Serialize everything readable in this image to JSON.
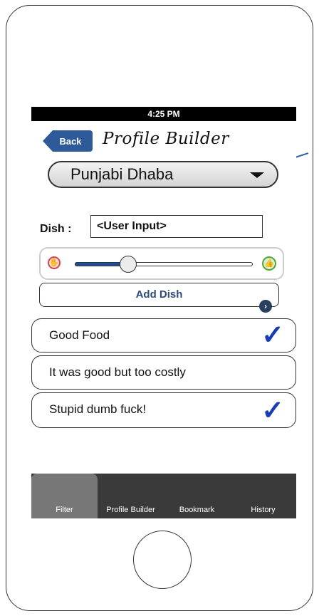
{
  "status_bar": {
    "time": "4:25 PM"
  },
  "nav": {
    "back_label": "Back",
    "title": "Profile Builder"
  },
  "restaurant_select": {
    "selected": "Punjabi Dhaba"
  },
  "dish": {
    "label": "Dish :",
    "value": "<User Input>"
  },
  "rating_slider": {
    "value": 0.3
  },
  "add_dish": {
    "label": "Add Dish"
  },
  "reviews": [
    {
      "text": "Good Food",
      "checked": true
    },
    {
      "text": "It was good but too costly",
      "checked": false
    },
    {
      "text": "Stupid dumb fuck!",
      "checked": true
    }
  ],
  "tabs": [
    {
      "label": "Filter",
      "active": true
    },
    {
      "label": "Profile Builder",
      "active": false
    },
    {
      "label": "Bookmark",
      "active": false
    },
    {
      "label": "History",
      "active": false
    }
  ],
  "colors": {
    "accent": "#2e5a9a",
    "check": "#1a3db4",
    "tabbar": "#3a3a3a"
  },
  "icons": [
    "thumbs-down-icon",
    "thumbs-up-icon",
    "chevron-down-icon",
    "disclosure-arrow-icon",
    "checkmark-icon"
  ]
}
